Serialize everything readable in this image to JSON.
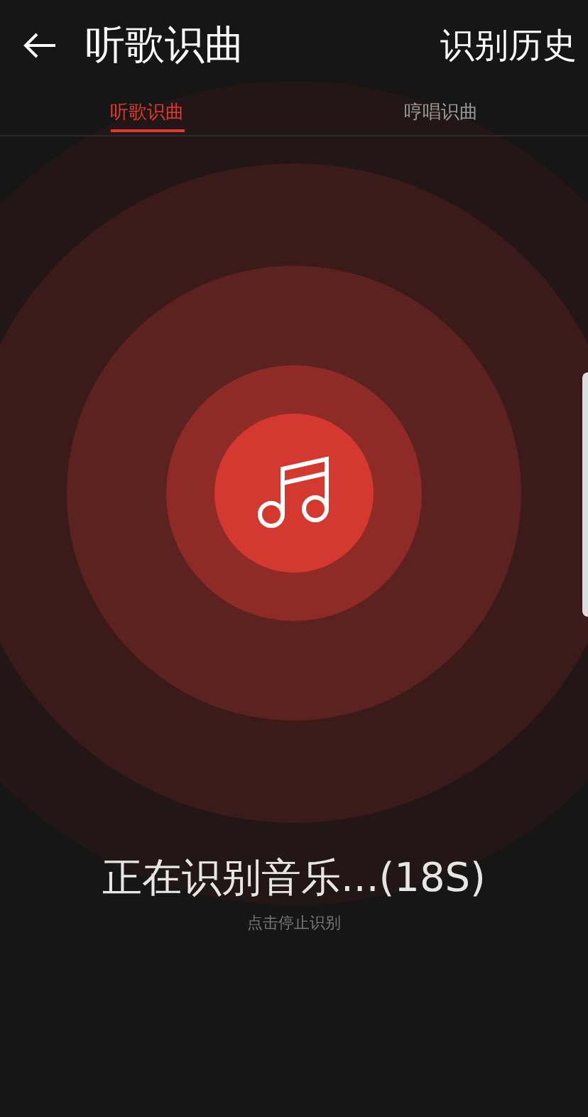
{
  "header": {
    "title": "听歌识曲",
    "action": "识别历史"
  },
  "tabs": [
    {
      "label": "听歌识曲",
      "selected": true
    },
    {
      "label": "哼唱识曲",
      "selected": false
    }
  ],
  "status": {
    "message": "正在识别音乐...(18S)",
    "hint": "点击停止识别"
  }
}
